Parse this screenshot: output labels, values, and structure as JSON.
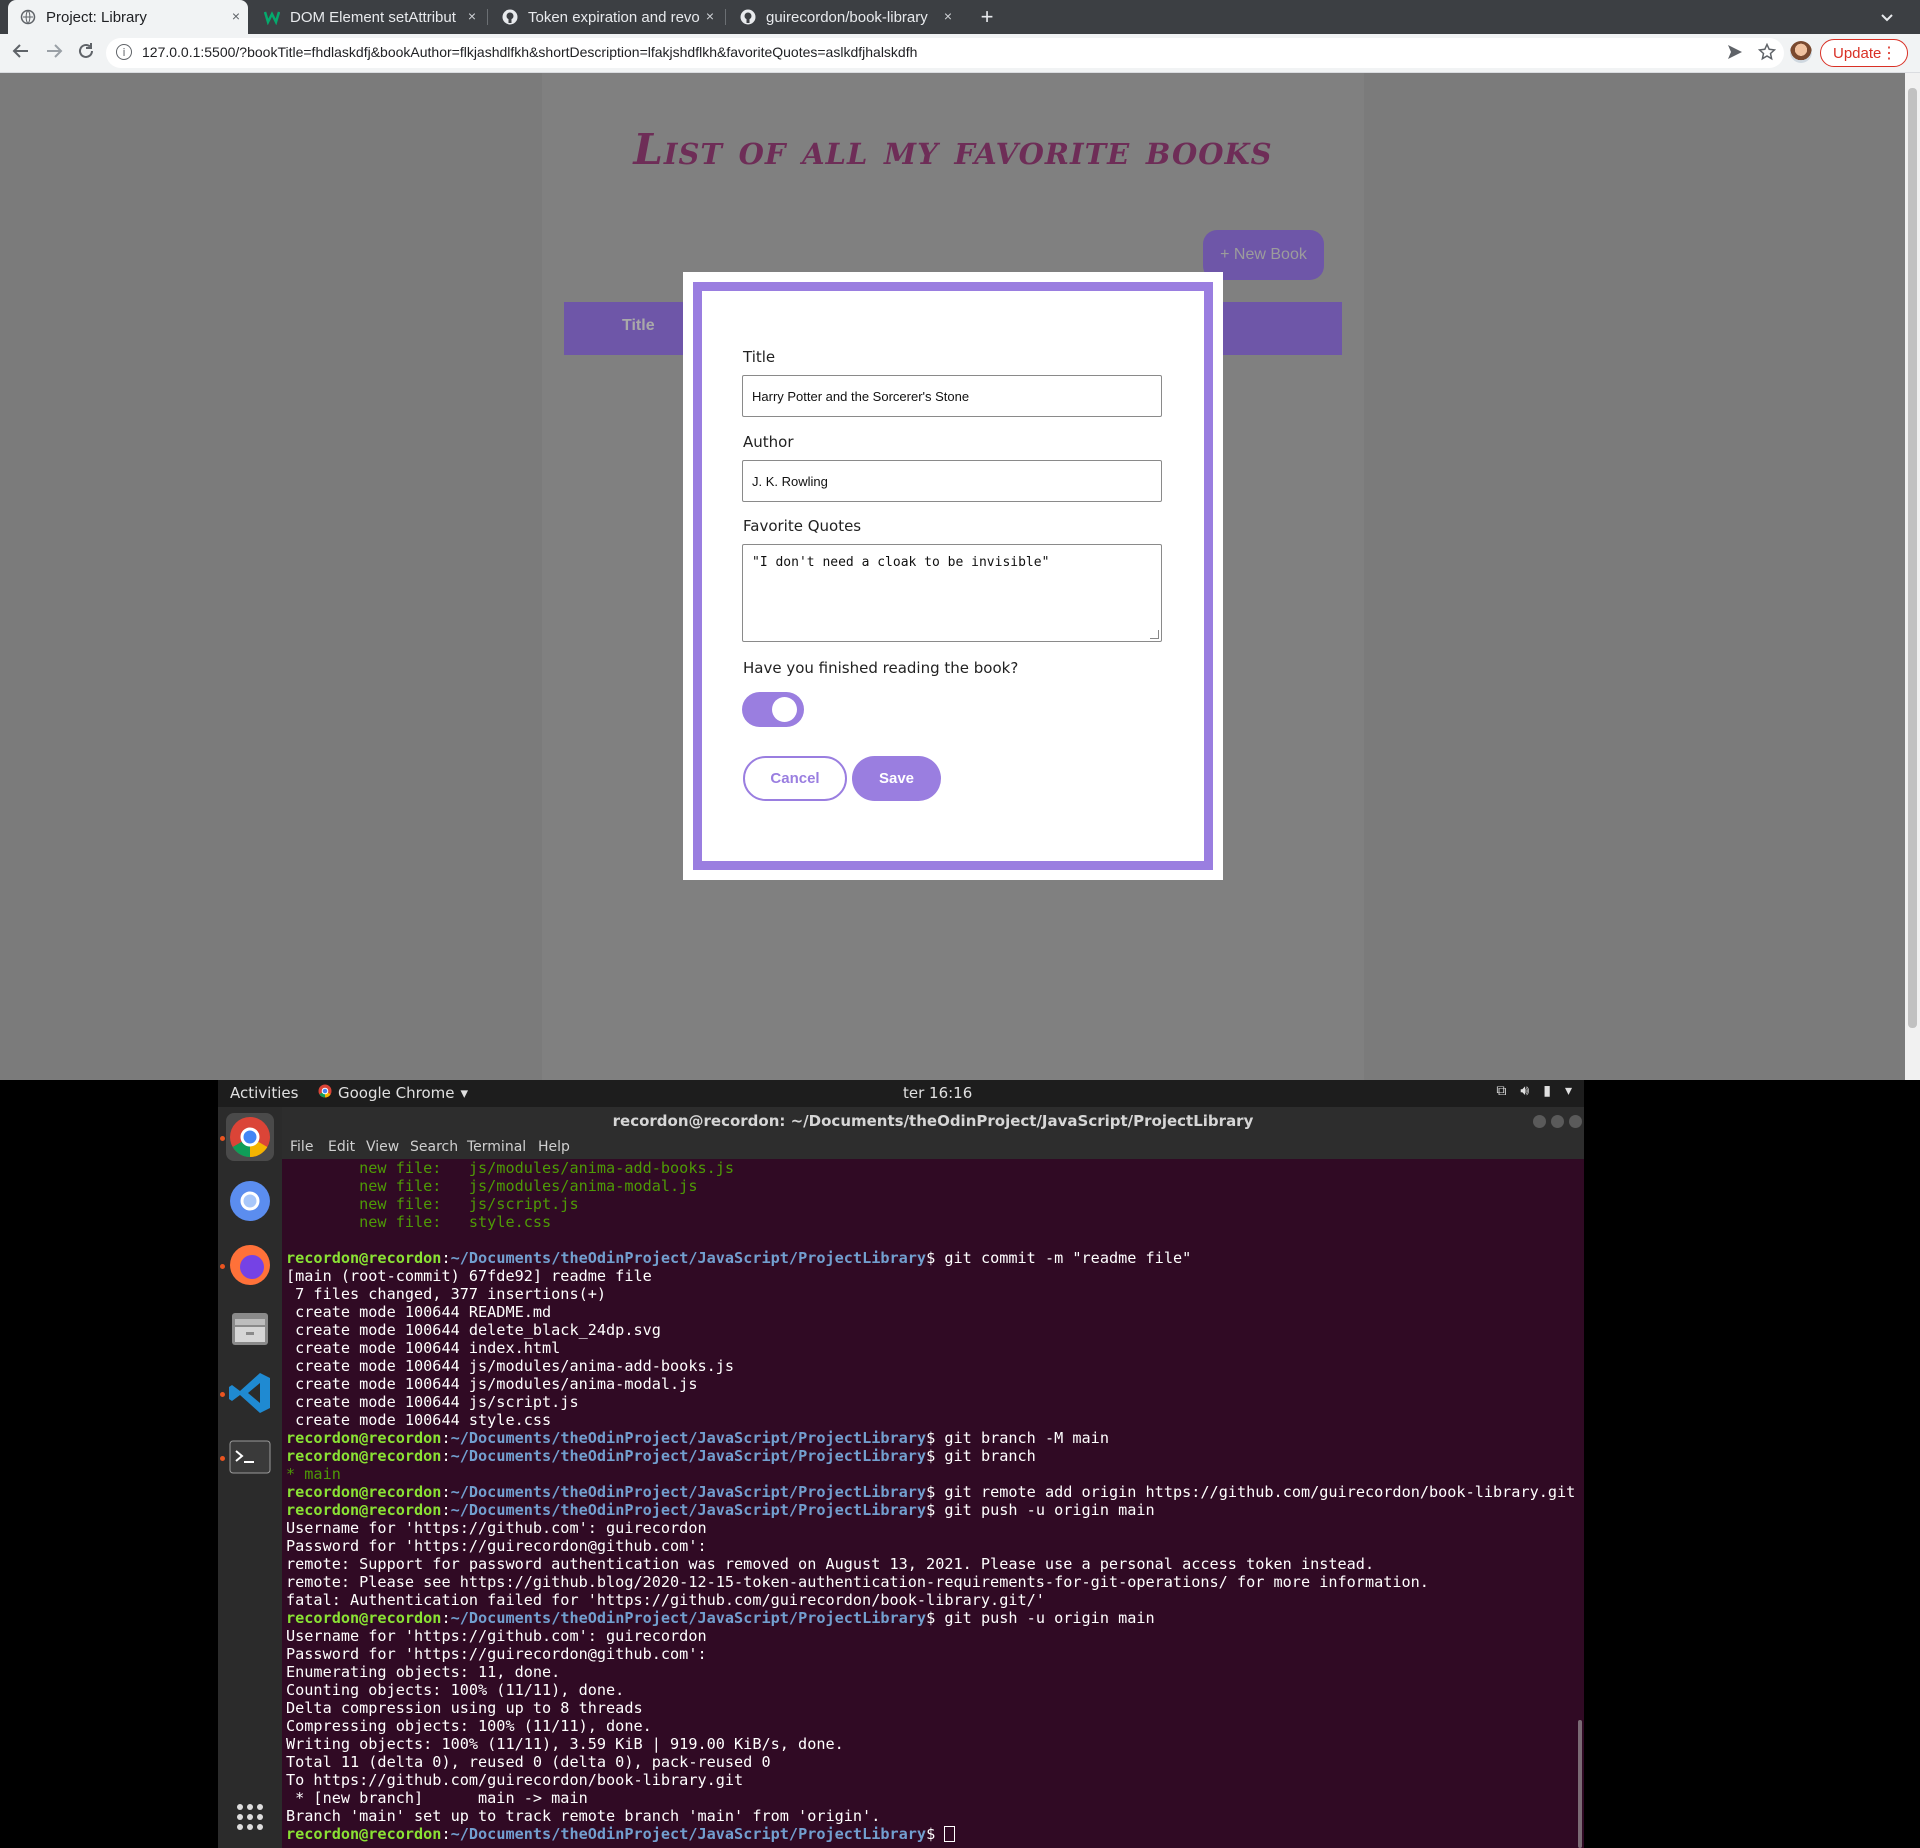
{
  "browser": {
    "tabs": [
      {
        "title": "Project: Library",
        "active": true,
        "icon": "page-icon"
      },
      {
        "title": "DOM Element setAttribut",
        "active": false,
        "icon": "w3schools-icon"
      },
      {
        "title": "Token expiration and revo",
        "active": false,
        "icon": "github-icon"
      },
      {
        "title": "guirecordon/book-library",
        "active": false,
        "icon": "github-icon"
      }
    ],
    "new_tab": "+",
    "tab_close": "×",
    "url": "127.0.0.1:5500/?bookTitle=fhdlaskdfj&bookAuthor=flkjashdlfkh&shortDescription=lfakjshdflkh&favoriteQuotes=aslkdfjhalskdfh",
    "update_label": "Update"
  },
  "page": {
    "title": "List of all my favorite books",
    "new_book_label": "+ New Book",
    "table_header_title": "Title"
  },
  "modal": {
    "title_label": "Title",
    "title_value": "Harry Potter and the Sorcerer's Stone",
    "author_label": "Author",
    "author_value": "J. K. Rowling",
    "quotes_label": "Favorite Quotes",
    "quotes_value": "\"I don't need a cloak to be invisible\"",
    "finished_label": "Have you finished reading the book?",
    "finished_checked": true,
    "cancel_label": "Cancel",
    "save_label": "Save"
  },
  "ubuntu": {
    "activities": "Activities",
    "app_menu": "Google Chrome",
    "clock": "ter 16:16"
  },
  "terminal": {
    "title": "recordon@recordon: ~/Documents/theOdinProject/JavaScript/ProjectLibrary",
    "menu": [
      "File",
      "Edit",
      "View",
      "Search",
      "Terminal",
      "Help"
    ],
    "user": "recordon@recordon",
    "path": "~/Documents/theOdinProject/JavaScript/ProjectLibrary",
    "lines": [
      {
        "type": "file",
        "text": "        new file:   js/modules/anima-add-books.js"
      },
      {
        "type": "file",
        "text": "        new file:   js/modules/anima-modal.js"
      },
      {
        "type": "file",
        "text": "        new file:   js/script.js"
      },
      {
        "type": "file",
        "text": "        new file:   style.css"
      },
      {
        "type": "plain",
        "text": ""
      },
      {
        "type": "prompt",
        "text": "git commit -m \"readme file\""
      },
      {
        "type": "plain",
        "text": "[main (root-commit) 67fde92] readme file"
      },
      {
        "type": "plain",
        "text": " 7 files changed, 377 insertions(+)"
      },
      {
        "type": "plain",
        "text": " create mode 100644 README.md"
      },
      {
        "type": "plain",
        "text": " create mode 100644 delete_black_24dp.svg"
      },
      {
        "type": "plain",
        "text": " create mode 100644 index.html"
      },
      {
        "type": "plain",
        "text": " create mode 100644 js/modules/anima-add-books.js"
      },
      {
        "type": "plain",
        "text": " create mode 100644 js/modules/anima-modal.js"
      },
      {
        "type": "plain",
        "text": " create mode 100644 js/script.js"
      },
      {
        "type": "plain",
        "text": " create mode 100644 style.css"
      },
      {
        "type": "prompt",
        "text": "git branch -M main"
      },
      {
        "type": "prompt",
        "text": "git branch"
      },
      {
        "type": "branch",
        "text": "* main"
      },
      {
        "type": "prompt",
        "text": "git remote add origin https://github.com/guirecordon/book-library.git"
      },
      {
        "type": "prompt",
        "text": "git push -u origin main"
      },
      {
        "type": "plain",
        "text": "Username for 'https://github.com': guirecordon"
      },
      {
        "type": "plain",
        "text": "Password for 'https://guirecordon@github.com':"
      },
      {
        "type": "plain",
        "text": "remote: Support for password authentication was removed on August 13, 2021. Please use a personal access token instead."
      },
      {
        "type": "plain",
        "text": "remote: Please see https://github.blog/2020-12-15-token-authentication-requirements-for-git-operations/ for more information."
      },
      {
        "type": "plain",
        "text": "fatal: Authentication failed for 'https://github.com/guirecordon/book-library.git/'"
      },
      {
        "type": "prompt",
        "text": "git push -u origin main"
      },
      {
        "type": "plain",
        "text": "Username for 'https://github.com': guirecordon"
      },
      {
        "type": "plain",
        "text": "Password for 'https://guirecordon@github.com':"
      },
      {
        "type": "plain",
        "text": "Enumerating objects: 11, done."
      },
      {
        "type": "plain",
        "text": "Counting objects: 100% (11/11), done."
      },
      {
        "type": "plain",
        "text": "Delta compression using up to 8 threads"
      },
      {
        "type": "plain",
        "text": "Compressing objects: 100% (11/11), done."
      },
      {
        "type": "plain",
        "text": "Writing objects: 100% (11/11), 3.59 KiB | 919.00 KiB/s, done."
      },
      {
        "type": "plain",
        "text": "Total 11 (delta 0), reused 0 (delta 0), pack-reused 0"
      },
      {
        "type": "plain",
        "text": "To https://github.com/guirecordon/book-library.git"
      },
      {
        "type": "plain",
        "text": " * [new branch]      main -> main"
      },
      {
        "type": "plain",
        "text": "Branch 'main' set up to track remote branch 'main' from 'origin'."
      },
      {
        "type": "prompt",
        "text": ""
      }
    ]
  },
  "colors": {
    "accent": "#9a7ee0",
    "title": "#6e2d57",
    "terminal_bg": "#300a24"
  }
}
